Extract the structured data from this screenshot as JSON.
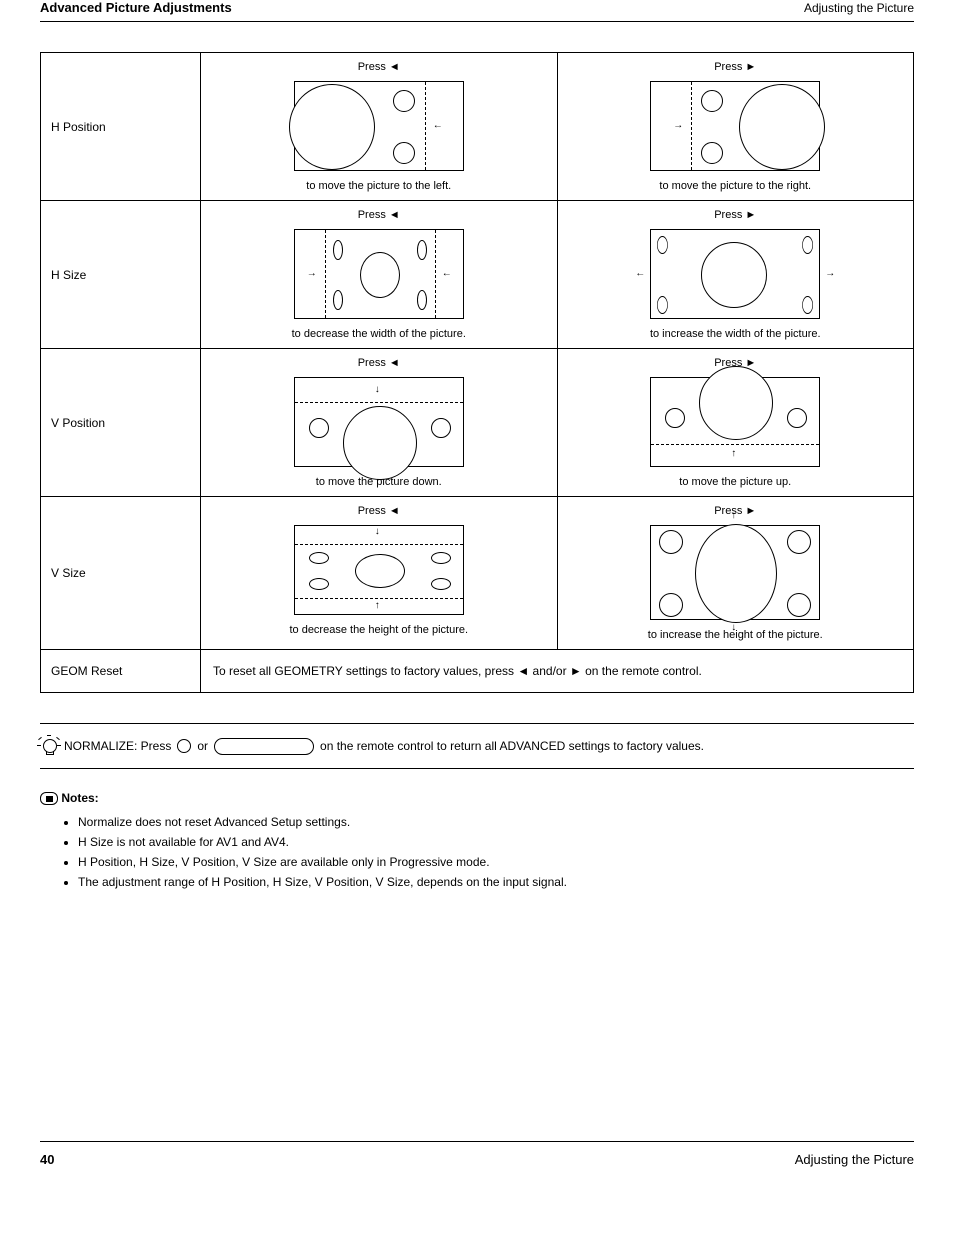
{
  "header": {
    "left": "Advanced Picture Adjustments",
    "right": "Adjusting the Picture"
  },
  "table": {
    "rows": [
      {
        "label": "H Position",
        "left_press": "Press ◄",
        "left_caption": "to move the picture to the left.",
        "right_press": "Press ►",
        "right_caption": "to move the picture to the right."
      },
      {
        "label": "H Size",
        "left_press": "Press ◄",
        "left_caption": "to decrease the width of the picture.",
        "right_press": "Press ►",
        "right_caption": "to increase the width of the picture."
      },
      {
        "label": "V Position",
        "left_press": "Press ◄",
        "left_caption": "to move the picture down.",
        "right_press": "Press ►",
        "right_caption": "to move the picture up."
      },
      {
        "label": "V Size",
        "left_press": "Press ◄",
        "left_caption": "to decrease the height of the picture.",
        "right_press": "Press ►",
        "right_caption": "to increase the height of the picture."
      }
    ],
    "reset": {
      "label": "GEOM Reset",
      "text": "To reset all GEOMETRY settings to factory values, press ◄ and/or ► on the remote control."
    }
  },
  "tip": {
    "lead": "NORMALIZE: Press",
    "or": "or",
    "tail": "on the remote control to return all ADVANCED settings to factory values."
  },
  "notes": {
    "title": "Notes:",
    "items": [
      "Normalize does not reset Advanced Setup settings.",
      "H Size is not available for AV1 and AV4.",
      "H Position, H Size, V Position, V Size are available only in Progressive mode.",
      "The adjustment range of H Position, H Size, V Position, V Size, depends on the input signal."
    ]
  },
  "footer": {
    "page": "40",
    "title": "Adjusting the Picture"
  }
}
